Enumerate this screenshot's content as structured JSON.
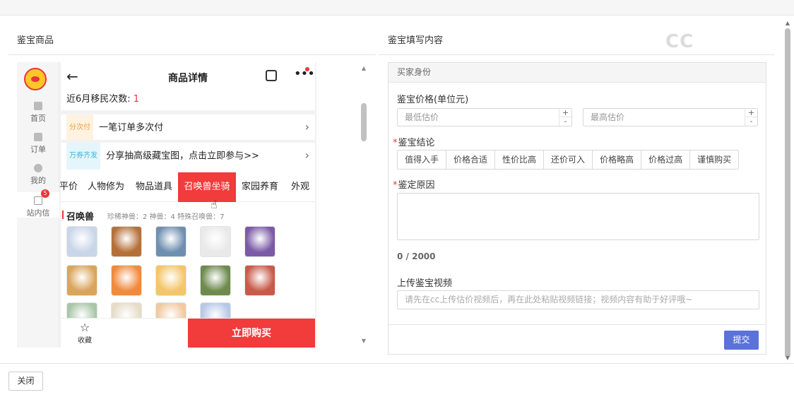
{
  "left_pane": {
    "title": "鉴宝商品"
  },
  "right_pane": {
    "title": "鉴宝填写内容"
  },
  "watermark": "CC",
  "phone": {
    "header": {
      "title": "商品详情"
    },
    "rail": [
      {
        "label": "首页"
      },
      {
        "label": "订单"
      },
      {
        "label": "我的"
      },
      {
        "label": "站内信",
        "badge": "5"
      }
    ],
    "migration": {
      "label": "近6月移民次数:",
      "value": "1"
    },
    "installments": {
      "tag": "分次付",
      "text": "一笔订单多次付"
    },
    "promo": {
      "tag": "万券齐发",
      "text": "分享抽高级藏宝图，点击立即参与>>"
    },
    "tabs": [
      "平价",
      "人物修为",
      "物品道具",
      "召唤兽坐骑",
      "家园养育",
      "外观"
    ],
    "active_tab": "召唤兽坐骑",
    "beasts": {
      "title": "召唤兽",
      "stats": "珍稀神兽：2   神兽：4   特殊召唤兽：7"
    },
    "avatars": [
      "#c8d6e8",
      "#b5703a",
      "#6f8fb0",
      "#e9e9e9",
      "#7b5aa6",
      "#d9a45b",
      "#f08a3c",
      "#f4c66a",
      "#6e8a4e",
      "#c95a4a",
      "#a9c6a8",
      "#e6dcc8",
      "#f1c9a0",
      "#b7c7e6"
    ],
    "bottom": {
      "fav_label": "收藏",
      "buy_label": "立即购买"
    }
  },
  "form": {
    "section": "买家身份",
    "price_label": "鉴宝价格(单位元)",
    "min_placeholder": "最低估价",
    "max_placeholder": "最高估价",
    "conclusion_label": "鉴宝结论",
    "conclusions": [
      "值得入手",
      "价格合适",
      "性价比高",
      "还价可入",
      "价格略高",
      "价格过高",
      "谨慎购买"
    ],
    "reason_label": "鉴定原因",
    "counter": "0 / 2000",
    "video_label": "上传鉴宝视频",
    "video_placeholder": "请先在cc上传估价视频后，再在此处粘贴视频链接；视频内容有助于好评哦~",
    "submit_label": "提交"
  },
  "close_label": "关闭",
  "colors": {
    "accent": "#f23b3b",
    "primary": "#5b72d9"
  }
}
